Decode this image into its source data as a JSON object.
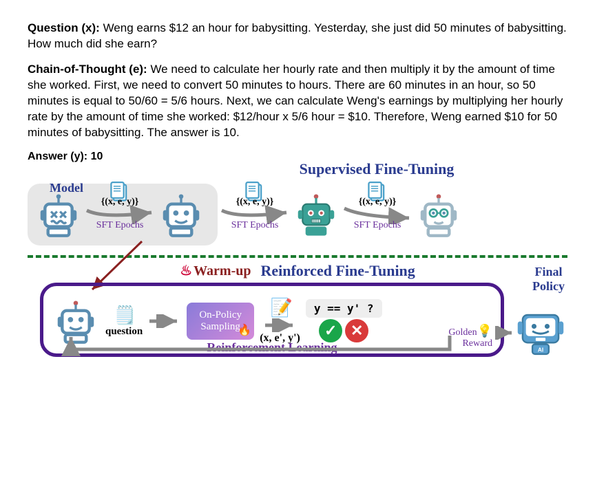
{
  "question": {
    "label": "Question (x):",
    "text": " Weng earns $12 an hour for babysitting. Yesterday, she just did 50 minutes of babysitting. How much did she earn?"
  },
  "cot": {
    "label": "Chain-of-Thought (e):",
    "text": " We need to calculate her hourly rate and then multiply it by the amount of time she worked. First, we need to convert 50 minutes to hours. There are 60 minutes in an hour, so 50 minutes is equal to 50/60 = 5/6 hours. Next, we can calculate Weng's earnings by multiplying her hourly rate by the amount of time she worked:  $12/hour x 5/6 hour = $10. Therefore, Weng earned $10 for 50 minutes of babysitting. The answer is 10."
  },
  "answer": {
    "label": "Answer (y):",
    "value": " 10"
  },
  "sft": {
    "title": "Supervised Fine-Tuning",
    "model_label": "Model",
    "tuple": "{(x, e, y)}",
    "epochs": "SFT Epochs"
  },
  "reft": {
    "warmup": "Warm-up",
    "title": "Reinforced Fine-Tuning",
    "final_policy": "Final\nPolicy",
    "question": "question",
    "sampling": "On-Policy Sampling",
    "tuple": "(x, e', y')",
    "condition": "y == y' ?",
    "golden": "Golden\nReward",
    "rl": "Reinforcement Learning"
  }
}
